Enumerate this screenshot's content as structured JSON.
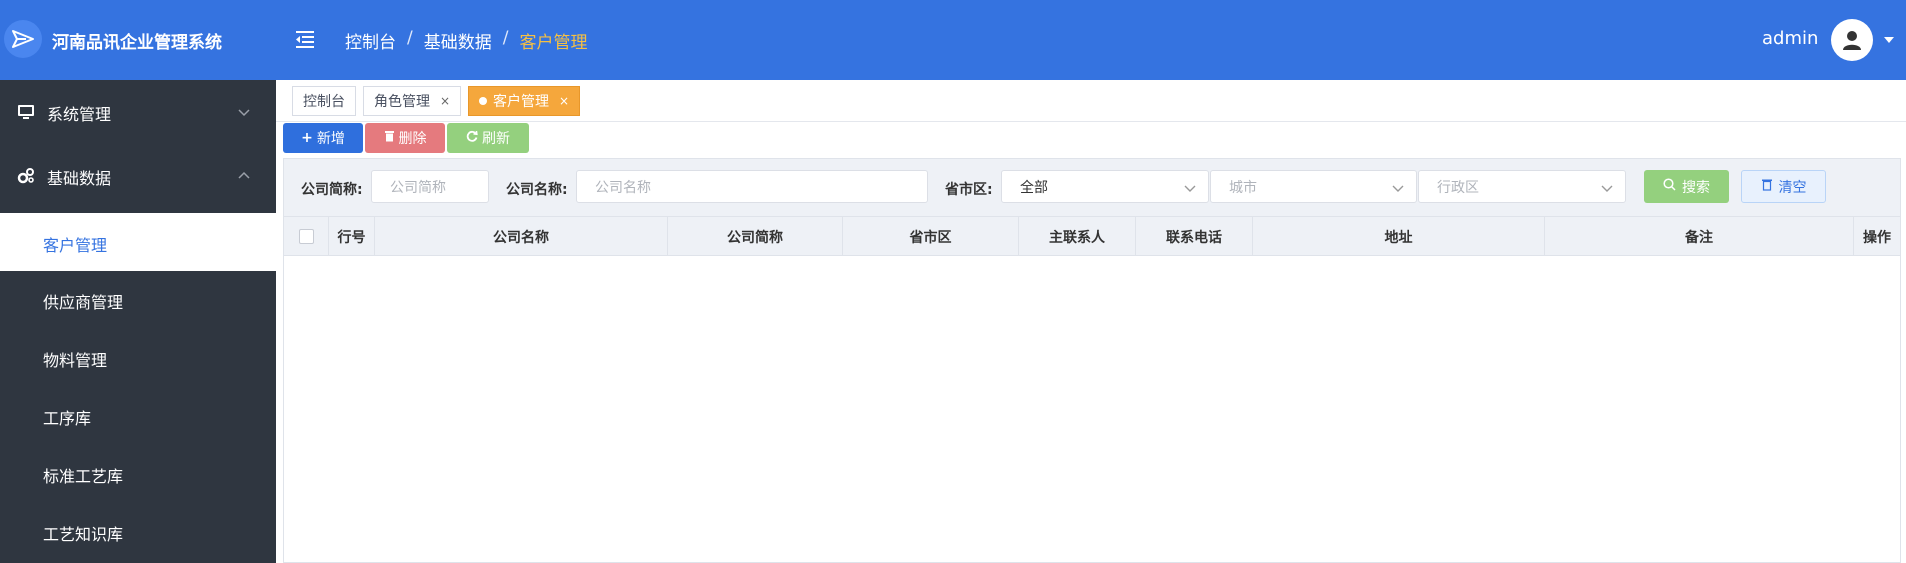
{
  "app": {
    "title": "河南品讯企业管理系统"
  },
  "breadcrumb": {
    "items": [
      "控制台",
      "基础数据",
      "客户管理"
    ],
    "separator": "/"
  },
  "user": {
    "name": "admin"
  },
  "sidebar": {
    "groups": [
      {
        "label": "系统管理",
        "icon": "monitor-icon",
        "expanded": false
      },
      {
        "label": "基础数据",
        "icon": "gears-icon",
        "expanded": true
      }
    ],
    "items": [
      {
        "label": "客户管理",
        "active": true
      },
      {
        "label": "供应商管理",
        "active": false
      },
      {
        "label": "物料管理",
        "active": false
      },
      {
        "label": "工序库",
        "active": false
      },
      {
        "label": "标准工艺库",
        "active": false
      },
      {
        "label": "工艺知识库",
        "active": false
      }
    ]
  },
  "tabs": [
    {
      "label": "控制台",
      "closable": false,
      "active": false
    },
    {
      "label": "角色管理",
      "closable": true,
      "active": false
    },
    {
      "label": "客户管理",
      "closable": true,
      "active": true
    }
  ],
  "toolbar": {
    "add_label": "新增",
    "delete_label": "删除",
    "refresh_label": "刷新"
  },
  "search": {
    "short_name_label": "公司简称:",
    "short_name_placeholder": "公司简称",
    "name_label": "公司名称:",
    "name_placeholder": "公司名称",
    "region_label": "省市区:",
    "province_value": "全部",
    "city_placeholder": "城市",
    "district_placeholder": "行政区",
    "search_label": "搜索",
    "clear_label": "清空"
  },
  "table": {
    "columns": [
      "行号",
      "公司名称",
      "公司简称",
      "省市区",
      "主联系人",
      "联系电话",
      "地址",
      "备注",
      "操作"
    ],
    "rows": []
  },
  "colors": {
    "header_bg": "#3573e0",
    "sidebar_bg": "#2f3640",
    "active_tab": "#f5a73c",
    "breadcrumb_current": "#f5c043"
  }
}
